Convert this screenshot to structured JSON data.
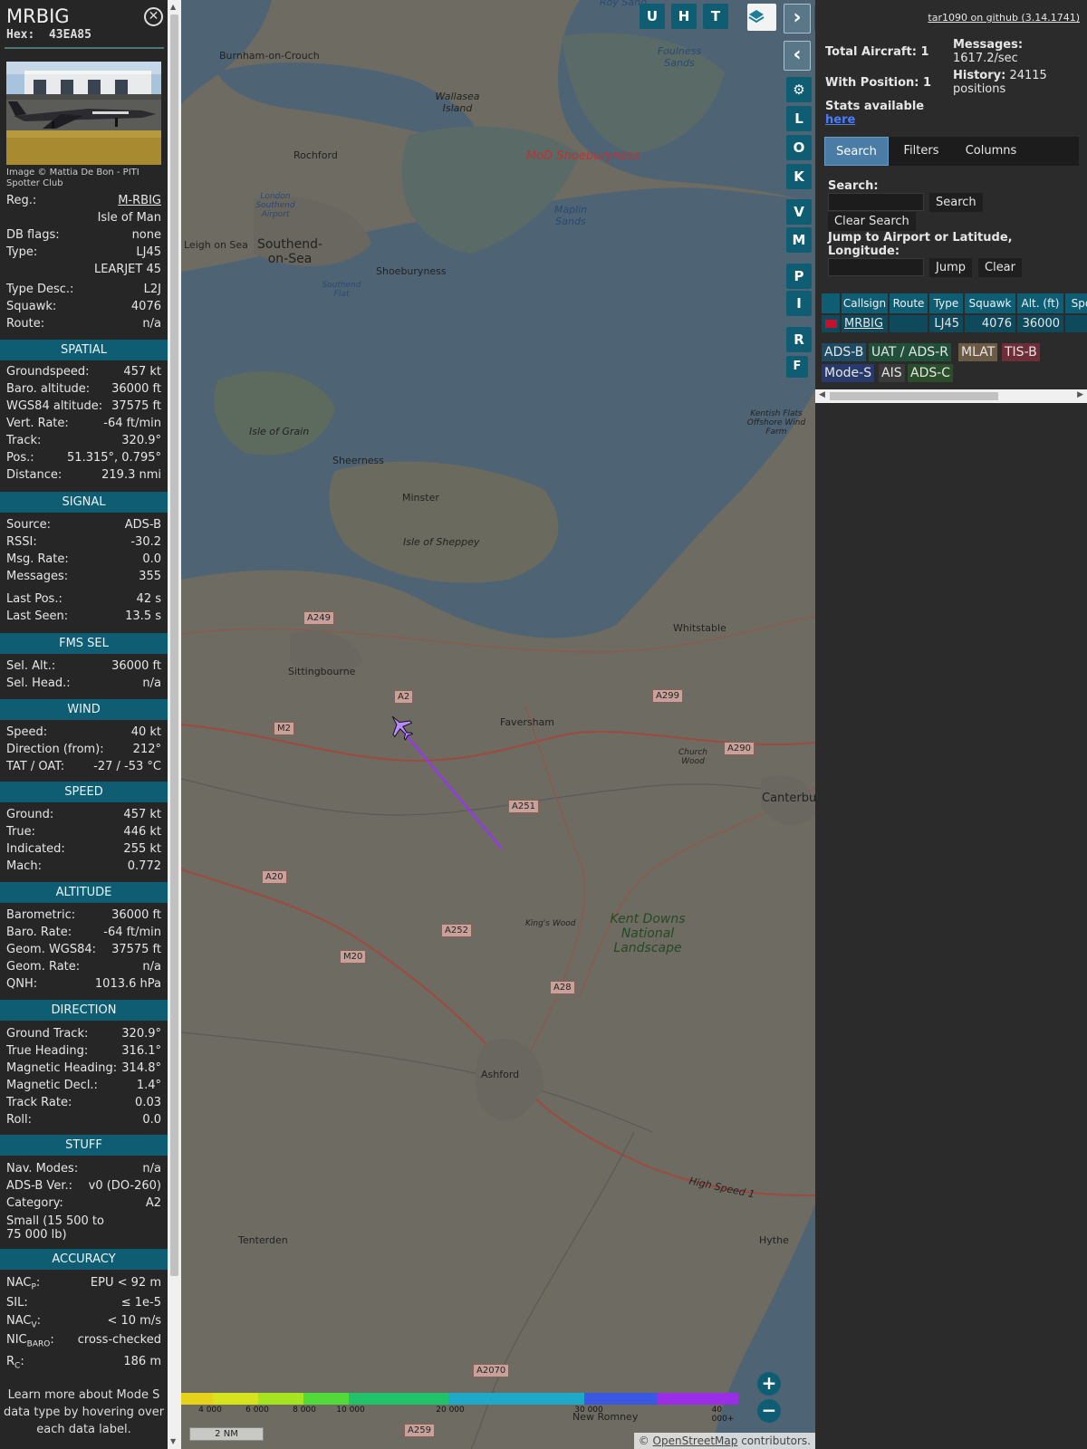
{
  "aircraft": {
    "callsign": "MRBIG",
    "hex_label": "Hex:",
    "hex": "43EA85",
    "photo_credit": "Image © Mattia De Bon - PITI Spotter Club"
  },
  "details": [
    {
      "label": "Reg.:",
      "value": "M-RBIG",
      "link": true
    },
    {
      "label": "",
      "value": "Isle of Man"
    },
    {
      "label": "DB flags:",
      "value": "none"
    },
    {
      "label": "Type:",
      "value": "LJ45"
    },
    {
      "label": "",
      "value": "LEARJET 45"
    },
    {
      "label": "Type Desc.:",
      "value": "L2J"
    },
    {
      "label": "Squawk:",
      "value": "4076"
    },
    {
      "label": "Route:",
      "value": "n/a"
    }
  ],
  "sections": {
    "spatial": {
      "title": "SPATIAL",
      "rows": [
        {
          "label": "Groundspeed:",
          "value": "457 kt"
        },
        {
          "label": "Baro. altitude:",
          "value": "36000 ft"
        },
        {
          "label": "WGS84 altitude:",
          "value": "37575 ft"
        },
        {
          "label": "Vert. Rate:",
          "value": "-64 ft/min"
        },
        {
          "label": "Track:",
          "value": "320.9°"
        },
        {
          "label": "Pos.:",
          "value": "51.315°, 0.795°"
        },
        {
          "label": "Distance:",
          "value": "219.3 nmi"
        }
      ]
    },
    "signal": {
      "title": "SIGNAL",
      "rows": [
        {
          "label": "Source:",
          "value": "ADS-B"
        },
        {
          "label": "RSSI:",
          "value": "-30.2"
        },
        {
          "label": "Msg. Rate:",
          "value": "0.0"
        },
        {
          "label": "Messages:",
          "value": "355"
        },
        {
          "label": "Last Pos.:",
          "value": "42 s"
        },
        {
          "label": "Last Seen:",
          "value": "13.5 s"
        }
      ]
    },
    "fms": {
      "title": "FMS SEL",
      "rows": [
        {
          "label": "Sel. Alt.:",
          "value": "36000 ft"
        },
        {
          "label": "Sel. Head.:",
          "value": "n/a"
        }
      ]
    },
    "wind": {
      "title": "WIND",
      "rows": [
        {
          "label": "Speed:",
          "value": "40 kt"
        },
        {
          "label": "Direction (from):",
          "value": "212°"
        },
        {
          "label": "TAT / OAT:",
          "value": "-27 / -53 °C"
        }
      ]
    },
    "speed": {
      "title": "SPEED",
      "rows": [
        {
          "label": "Ground:",
          "value": "457 kt"
        },
        {
          "label": "True:",
          "value": "446 kt"
        },
        {
          "label": "Indicated:",
          "value": "255 kt"
        },
        {
          "label": "Mach:",
          "value": "0.772"
        }
      ]
    },
    "altitude": {
      "title": "ALTITUDE",
      "rows": [
        {
          "label": "Barometric:",
          "value": "36000 ft"
        },
        {
          "label": "Baro. Rate:",
          "value": "-64 ft/min"
        },
        {
          "label": "Geom. WGS84:",
          "value": "37575 ft"
        },
        {
          "label": "Geom. Rate:",
          "value": "n/a"
        },
        {
          "label": "QNH:",
          "value": "1013.6 hPa"
        }
      ]
    },
    "direction": {
      "title": "DIRECTION",
      "rows": [
        {
          "label": "Ground Track:",
          "value": "320.9°"
        },
        {
          "label": "True Heading:",
          "value": "316.1°"
        },
        {
          "label": "Magnetic Heading:",
          "value": "314.8°"
        },
        {
          "label": "Magnetic Decl.:",
          "value": "1.4°"
        },
        {
          "label": "Track Rate:",
          "value": "0.03"
        },
        {
          "label": "Roll:",
          "value": "0.0"
        }
      ]
    },
    "stuff": {
      "title": "STUFF",
      "rows": [
        {
          "label": "Nav. Modes:",
          "value": "n/a"
        },
        {
          "label": "ADS-B Ver.:",
          "value": "v0 (DO-260)"
        },
        {
          "label": "Category:",
          "value": "A2"
        }
      ],
      "category_desc": "Small (15 500 to 75 000 lb)"
    },
    "accuracy": {
      "title": "ACCURACY",
      "nacp_label": "NAC",
      "nacp_sub": "P",
      "nacp_value": "EPU < 92 m",
      "sil_label": "SIL:",
      "sil_value": "≤ 1e-5",
      "nacv_label": "NAC",
      "nacv_sub": "V",
      "nacv_value": "< 10 m/s",
      "nicbaro_label": "NIC",
      "nicbaro_sub": "BARO",
      "nicbaro_value": "cross-checked",
      "rc_label": "R",
      "rc_sub": "C",
      "rc_value": "186 m"
    }
  },
  "footer_note": "Learn more about Mode S data type by hovering over each data label.",
  "map": {
    "buttons_top": [
      "U",
      "H",
      "T"
    ],
    "buttons_side": [
      "L",
      "O",
      "K",
      "V",
      "M",
      "P",
      "I",
      "R",
      "F"
    ],
    "places": [
      {
        "name": "Burnham-on-Crouch",
        "kind": "town"
      },
      {
        "name": "Foulness Sands",
        "kind": "water"
      },
      {
        "name": "Wallasea Island",
        "kind": "town"
      },
      {
        "name": "Roy Sand",
        "kind": "water"
      },
      {
        "name": "Rochford",
        "kind": "town"
      },
      {
        "name": "MoD Shoeburyness",
        "kind": "military"
      },
      {
        "name": "London Southend Airport",
        "kind": "water"
      },
      {
        "name": "Maplin Sands",
        "kind": "water"
      },
      {
        "name": "Leigh on Sea",
        "kind": "town"
      },
      {
        "name": "Southend-on-Sea",
        "kind": "city"
      },
      {
        "name": "Shoeburyness",
        "kind": "town"
      },
      {
        "name": "Southend Flat",
        "kind": "water"
      },
      {
        "name": "Isle of Grain",
        "kind": "town"
      },
      {
        "name": "Sheerness",
        "kind": "town"
      },
      {
        "name": "Minster",
        "kind": "town"
      },
      {
        "name": "Isle of Sheppey",
        "kind": "town"
      },
      {
        "name": "Kentish Flats Offshore Wind Farm",
        "kind": "town"
      },
      {
        "name": "Whitstable",
        "kind": "town"
      },
      {
        "name": "Sittingbourne",
        "kind": "town"
      },
      {
        "name": "Faversham",
        "kind": "town"
      },
      {
        "name": "Church Wood",
        "kind": "town"
      },
      {
        "name": "Canterbury",
        "kind": "city"
      },
      {
        "name": "King's Wood",
        "kind": "town"
      },
      {
        "name": "Kent Downs National Landscape",
        "kind": "park"
      },
      {
        "name": "Ashford",
        "kind": "town"
      },
      {
        "name": "Tenterden",
        "kind": "town"
      },
      {
        "name": "Hythe",
        "kind": "town"
      },
      {
        "name": "New Romney",
        "kind": "town"
      },
      {
        "name": "High Speed 1",
        "kind": "rail"
      }
    ],
    "roads": [
      "A249",
      "A2",
      "A299",
      "M2",
      "A290",
      "A251",
      "A20",
      "A252",
      "M20",
      "A28",
      "A2070",
      "A259"
    ],
    "altitude_legend": {
      "ticks": [
        "4 000",
        "6 000",
        "8 000",
        "10 000",
        "20 000",
        "30 000",
        "40 000+"
      ]
    },
    "scale": "2 NM",
    "credit_prefix": "© ",
    "credit_link": "OpenStreetMap",
    "credit_suffix": " contributors."
  },
  "side": {
    "github": "tar1090 on github (3.14.1741)",
    "total_aircraft": "Total Aircraft: 1",
    "with_position": "With Position: 1",
    "messages_label": "Messages:",
    "messages_value": "1617.2/sec",
    "history_label": "History:",
    "history_value": "24115 positions",
    "stats_text": "Stats available",
    "stats_link": "here",
    "tabs": [
      "Search",
      "Filters",
      "Columns"
    ],
    "search_label": "Search:",
    "search_button": "Search",
    "clear_search_button": "Clear Search",
    "jump_label": "Jump to Airport or Latitude, Longitude:",
    "jump_button": "Jump",
    "clear_button": "Clear",
    "table_headers": [
      "",
      "Callsign",
      "Route",
      "Type",
      "Squawk",
      "Alt. (ft)",
      "Spd."
    ],
    "table_row": {
      "callsign": "MRBIG",
      "route": "",
      "type": "LJ45",
      "squawk": "4076",
      "alt": "36000"
    },
    "sources": [
      "ADS-B",
      "UAT / ADS-R",
      "MLAT",
      "TIS-B",
      "Mode-S",
      "AIS",
      "ADS-C"
    ]
  },
  "colors": {
    "accent": "#0f5d73",
    "track": "#9b30ff",
    "adsb": "#1e4a63",
    "uat": "#21503a",
    "mlat": "#6b5a44",
    "tisb": "#6d2e38",
    "modes": "#273a6b",
    "ais": "#3a3a3a",
    "adsc": "#2a4d2a"
  }
}
